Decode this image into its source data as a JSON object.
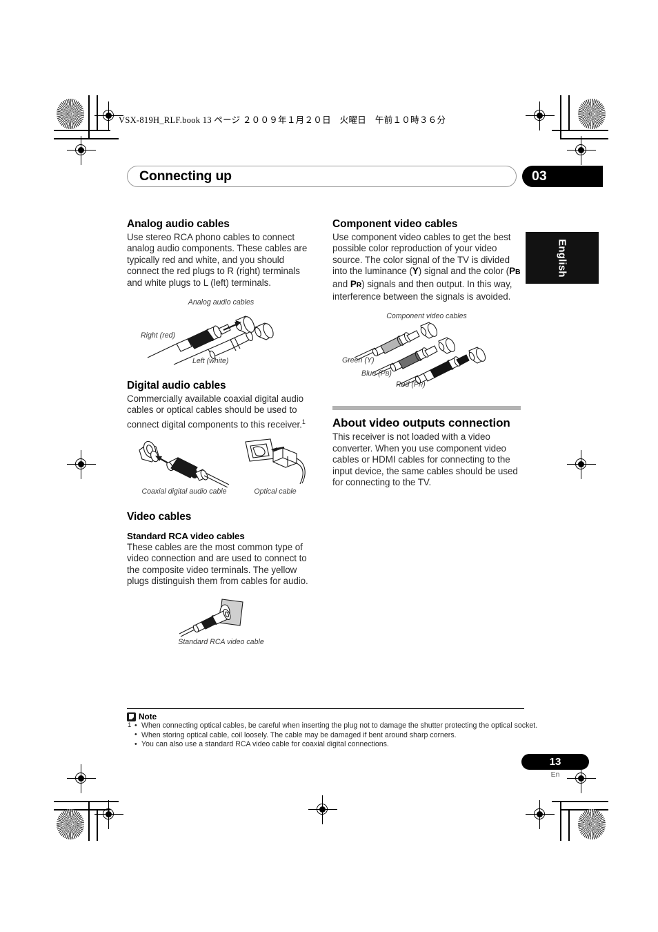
{
  "print_header": {
    "text": "VSX-819H_RLF.book  13 ページ  ２００９年１月２０日　火曜日　午前１０時３６分"
  },
  "running_head": {
    "title": "Connecting up",
    "chapter_number": "03"
  },
  "language_tab": {
    "label": "English"
  },
  "left_column": {
    "analog_audio": {
      "heading": "Analog audio cables",
      "body": "Use stereo RCA phono cables to connect analog audio components. These cables are typically red and white, and you should connect the red plugs to R (right) terminals and white plugs to L (left) terminals.",
      "figure": {
        "caption": "Analog audio cables",
        "label_right": "Right (red)",
        "label_left": "Left (white)"
      }
    },
    "digital_audio": {
      "heading": "Digital audio cables",
      "body_part1": "Commercially available coaxial digital audio cables or optical cables should be used to connect digital components to this receiver.",
      "footnote_marker": "1",
      "figure": {
        "caption_coaxial": "Coaxial digital audio cable",
        "caption_optical": "Optical cable"
      }
    },
    "video_cables": {
      "heading": "Video cables",
      "subheading": "Standard RCA video cables",
      "body": "These cables are the most common type of video connection and are used to connect to the composite video terminals. The yellow plugs distinguish them from cables for audio.",
      "figure": {
        "caption": "Standard RCA video cable"
      }
    }
  },
  "right_column": {
    "component_video": {
      "heading": "Component video cables",
      "body_part1": "Use component video cables to get the best possible color reproduction of your video source. The color signal of the TV is divided into the luminance (",
      "sym_y": "Y",
      "body_part2": ") signal and the color (",
      "sym_pb_main": "P",
      "sym_pb_sub": "B",
      "body_part3": " and ",
      "sym_pr_main": "P",
      "sym_pr_sub": "R",
      "body_part4": ") signals and then output. In this way, interference between the signals is avoided.",
      "figure": {
        "caption": "Component video cables",
        "label_green": "Green (Y)",
        "label_blue_main": "Blue (P",
        "label_blue_sub": "B",
        "label_blue_end": ")",
        "label_red_main": "Red (P",
        "label_red_sub": "R",
        "label_red_end": ")"
      }
    },
    "about_video_outputs": {
      "heading": "About video outputs connection",
      "body": "This receiver is not loaded with a video converter. When you use component video cables or HDMI cables for connecting to the input device, the same cables should be used for connecting to the TV."
    }
  },
  "note": {
    "title": "Note",
    "footnote_number": "1",
    "items": [
      "When connecting optical cables, be careful when inserting the plug not to damage the shutter protecting the optical socket.",
      "When storing optical cable, coil loosely. The cable may be damaged if bent around sharp corners.",
      "You can also use a standard RCA video cable for coaxial digital connections."
    ]
  },
  "folio": {
    "page_number": "13",
    "language_code": "En"
  },
  "colors": {
    "chapter_tab": "#000000",
    "rule_gray": "#b3b3b3",
    "body_text": "#2b2b2b"
  }
}
